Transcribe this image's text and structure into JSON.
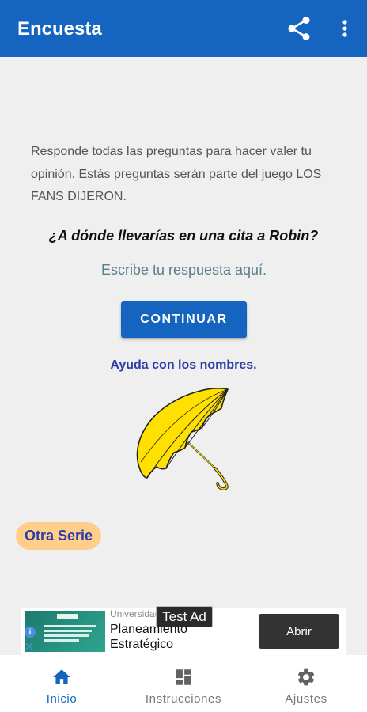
{
  "appbar": {
    "title": "Encuesta",
    "share_icon": "share-icon",
    "more_icon": "more-vert-icon",
    "color": "#1565c0"
  },
  "intro": {
    "text": "Responde todas las preguntas para hacer valer tu opinión. Estás preguntas serán parte del juego LOS FANS DIJERON."
  },
  "question": {
    "text": "¿A dónde llevarías en una cita a Robin?"
  },
  "answer": {
    "placeholder": "Escribe tu respuesta aquí.",
    "value": ""
  },
  "buttons": {
    "continue_label": "CONTINUAR"
  },
  "help": {
    "label": "Ayuda con los nombres."
  },
  "illustration": {
    "icon": "yellow-umbrella",
    "color": "#ffe000"
  },
  "other_series": {
    "label": "Otra Serie",
    "color": "#ffce8a"
  },
  "ad": {
    "advertiser": "Universidad",
    "headline": "Planeamiento Estratégico",
    "cta_label": "Abrir",
    "badge": "Test Ad"
  },
  "bottom_nav": {
    "items": [
      {
        "label": "Inicio",
        "icon": "home-icon",
        "active": true
      },
      {
        "label": "Instrucciones",
        "icon": "dashboard-icon",
        "active": false
      },
      {
        "label": "Ajustes",
        "icon": "settings-icon",
        "active": false
      }
    ]
  }
}
